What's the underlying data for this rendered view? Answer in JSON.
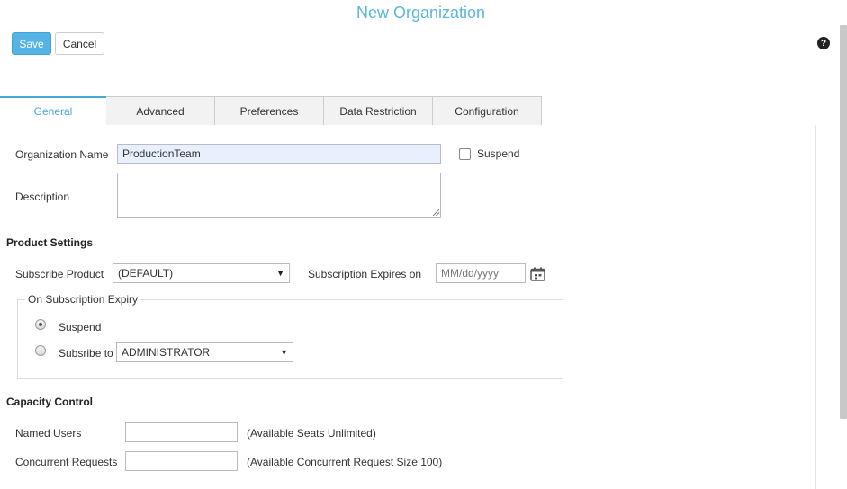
{
  "header": {
    "title": "New Organization",
    "save_label": "Save",
    "cancel_label": "Cancel",
    "help_icon": "?"
  },
  "tabs": [
    {
      "label": "General",
      "active": true
    },
    {
      "label": "Advanced",
      "active": false
    },
    {
      "label": "Preferences",
      "active": false
    },
    {
      "label": "Data Restriction",
      "active": false
    },
    {
      "label": "Configuration",
      "active": false
    }
  ],
  "general": {
    "org_name_label": "Organization Name",
    "org_name_value": "ProductionTeam",
    "suspend_label": "Suspend",
    "suspend_checked": false,
    "description_label": "Description",
    "description_value": ""
  },
  "product_settings": {
    "heading": "Product Settings",
    "subscribe_product_label": "Subscribe Product",
    "subscribe_product_value": "(DEFAULT)",
    "expires_label": "Subscription Expires on",
    "expires_placeholder": "MM/dd/yyyy",
    "expiry": {
      "legend": "On Subscription Expiry",
      "suspend_label": "Suspend",
      "suspend_selected": true,
      "subscribe_to_label": "Subsribe to",
      "subscribe_to_value": "ADMINISTRATOR"
    }
  },
  "capacity": {
    "heading": "Capacity Control",
    "named_users_label": "Named Users",
    "named_users_value": "",
    "named_users_note": "(Available Seats Unlimited)",
    "concurrent_label": "Concurrent Requests",
    "concurrent_value": "",
    "concurrent_note": "(Available Concurrent Request Size 100)"
  },
  "colors": {
    "accent": "#47a8d6",
    "save_button": "#55b4e3",
    "title": "#5bb7dc"
  }
}
